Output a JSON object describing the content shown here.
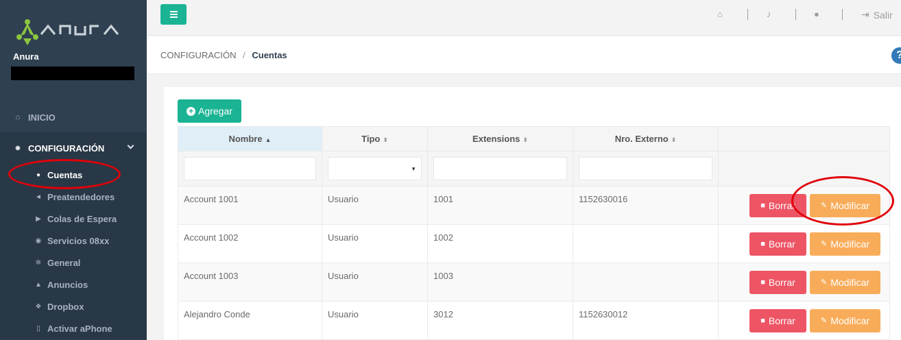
{
  "brand": {
    "logo_text": "Anura",
    "user_name": "Anura"
  },
  "colors": {
    "accent": "#1ab394",
    "sidebar": "#2f4050",
    "danger": "#ed5565",
    "warning": "#f8ac59",
    "annotation": "#e0000a"
  },
  "sidebar": {
    "inicio": "INICIO",
    "configuracion": "CONFIGURACIÓN",
    "items": [
      {
        "label": "Cuentas",
        "icon": "user-icon"
      },
      {
        "label": "Preatendedores",
        "icon": "bullhorn-icon"
      },
      {
        "label": "Colas de Espera",
        "icon": "play-square-icon"
      },
      {
        "label": "Servicios 08xx",
        "icon": "globe-icon"
      },
      {
        "label": "General",
        "icon": "gears-icon"
      },
      {
        "label": "Anuncios",
        "icon": "upload-icon"
      },
      {
        "label": "Dropbox",
        "icon": "dropbox-icon"
      },
      {
        "label": "Activar aPhone",
        "icon": "mobile-icon"
      }
    ]
  },
  "topbar": {
    "salir": "Salir"
  },
  "breadcrumb": {
    "parent": "CONFIGURACIÓN",
    "separator": "/",
    "current": "Cuentas",
    "help": "?"
  },
  "toolbar": {
    "agregar": "Agregar"
  },
  "table": {
    "columns": [
      "Nombre",
      "Tipo",
      "Extensions",
      "Nro. Externo",
      ""
    ],
    "rows": [
      {
        "nombre": "Account 1001",
        "tipo": "Usuario",
        "ext": "1001",
        "externo": "1152630016"
      },
      {
        "nombre": "Account 1002",
        "tipo": "Usuario",
        "ext": "1002",
        "externo": ""
      },
      {
        "nombre": "Account 1003",
        "tipo": "Usuario",
        "ext": "1003",
        "externo": ""
      },
      {
        "nombre": "Alejandro Conde",
        "tipo": "Usuario",
        "ext": "3012",
        "externo": "1152630012"
      }
    ],
    "borrar": "Borrar",
    "modificar": "Modificar"
  }
}
